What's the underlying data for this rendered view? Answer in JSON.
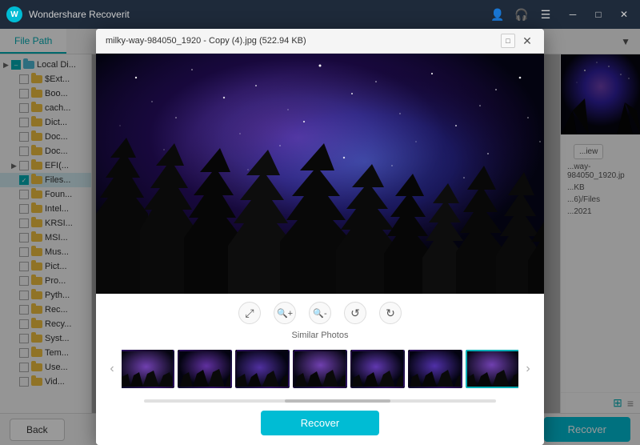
{
  "app": {
    "title": "Wondershare Recoverit",
    "logo_letter": "W"
  },
  "title_bar": {
    "minimize_label": "─",
    "maximize_label": "□",
    "close_label": "✕"
  },
  "tabs": {
    "file_path_label": "File Path",
    "filter_icon": "▼"
  },
  "sidebar": {
    "items": [
      {
        "label": "Local Di...",
        "level": 0,
        "arrow": "▶",
        "checked": "indeterminate",
        "folder_type": "blue"
      },
      {
        "label": "$Ext...",
        "level": 1,
        "arrow": " ",
        "checked": "unchecked",
        "folder_type": "normal"
      },
      {
        "label": "Boo...",
        "level": 1,
        "arrow": " ",
        "checked": "unchecked",
        "folder_type": "normal"
      },
      {
        "label": "cach...",
        "level": 1,
        "arrow": " ",
        "checked": "unchecked",
        "folder_type": "normal"
      },
      {
        "label": "Dict...",
        "level": 1,
        "arrow": " ",
        "checked": "unchecked",
        "folder_type": "normal"
      },
      {
        "label": "Doc...",
        "level": 1,
        "arrow": " ",
        "checked": "unchecked",
        "folder_type": "normal"
      },
      {
        "label": "Doc...",
        "level": 1,
        "arrow": " ",
        "checked": "unchecked",
        "folder_type": "normal"
      },
      {
        "label": "EFI(...",
        "level": 1,
        "arrow": "▶",
        "checked": "unchecked",
        "folder_type": "normal"
      },
      {
        "label": "Files...",
        "level": 1,
        "arrow": " ",
        "checked": "checked",
        "folder_type": "normal",
        "selected": true
      },
      {
        "label": "Foun...",
        "level": 1,
        "arrow": " ",
        "checked": "unchecked",
        "folder_type": "normal"
      },
      {
        "label": "Intel...",
        "level": 1,
        "arrow": " ",
        "checked": "unchecked",
        "folder_type": "normal"
      },
      {
        "label": "KRSI...",
        "level": 1,
        "arrow": " ",
        "checked": "unchecked",
        "folder_type": "normal"
      },
      {
        "label": "MSI...",
        "level": 1,
        "arrow": " ",
        "checked": "unchecked",
        "folder_type": "normal"
      },
      {
        "label": "Mus...",
        "level": 1,
        "arrow": " ",
        "checked": "unchecked",
        "folder_type": "normal"
      },
      {
        "label": "Pict...",
        "level": 1,
        "arrow": " ",
        "checked": "unchecked",
        "folder_type": "normal"
      },
      {
        "label": "Pro...",
        "level": 1,
        "arrow": " ",
        "checked": "unchecked",
        "folder_type": "normal"
      },
      {
        "label": "Pyth...",
        "level": 1,
        "arrow": " ",
        "checked": "unchecked",
        "folder_type": "normal"
      },
      {
        "label": "Rec...",
        "level": 1,
        "arrow": " ",
        "checked": "unchecked",
        "folder_type": "normal"
      },
      {
        "label": "Recy...",
        "level": 1,
        "arrow": " ",
        "checked": "unchecked",
        "folder_type": "normal"
      },
      {
        "label": "Syst...",
        "level": 1,
        "arrow": " ",
        "checked": "unchecked",
        "folder_type": "normal"
      },
      {
        "label": "Tem...",
        "level": 1,
        "arrow": " ",
        "checked": "unchecked",
        "folder_type": "normal"
      },
      {
        "label": "Use...",
        "level": 1,
        "arrow": " ",
        "checked": "unchecked",
        "folder_type": "normal"
      },
      {
        "label": "Vid...",
        "level": 1,
        "arrow": " ",
        "checked": "unchecked",
        "folder_type": "normal"
      }
    ]
  },
  "right_panel": {
    "view_btn_label": "...iew",
    "filename": "...way-984050_1920.jp",
    "size": "...KB",
    "path": "...6)/Files",
    "date": "...2021"
  },
  "modal": {
    "title": "milky-way-984050_1920 - Copy (4).jpg (522.94 KB)",
    "controls": {
      "fullscreen": "⤢",
      "zoom_in": "🔍",
      "zoom_out": "🔍",
      "rotate_left": "↺",
      "rotate_right": "↻"
    },
    "similar_photos_label": "Similar Photos",
    "thumb_count": 7,
    "selected_thumb_index": 6,
    "recover_btn_label": "Recover"
  },
  "bottom_bar": {
    "back_btn_label": "Back",
    "recover_btn_label": "Recover"
  }
}
